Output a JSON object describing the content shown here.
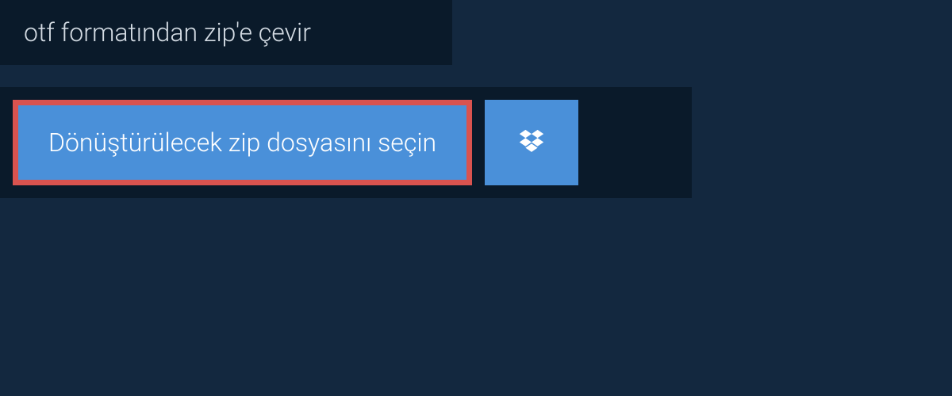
{
  "header": {
    "title": "otf formatından zip'e çevir"
  },
  "upload": {
    "select_button_label": "Dönüştürülecek zip dosyasını seçin"
  },
  "colors": {
    "page_bg": "#13283f",
    "panel_bg": "#0a1a2a",
    "button_bg": "#4a90d9",
    "highlight_border": "#d9534f",
    "text_light": "#d4dce4",
    "text_white": "#ffffff"
  }
}
